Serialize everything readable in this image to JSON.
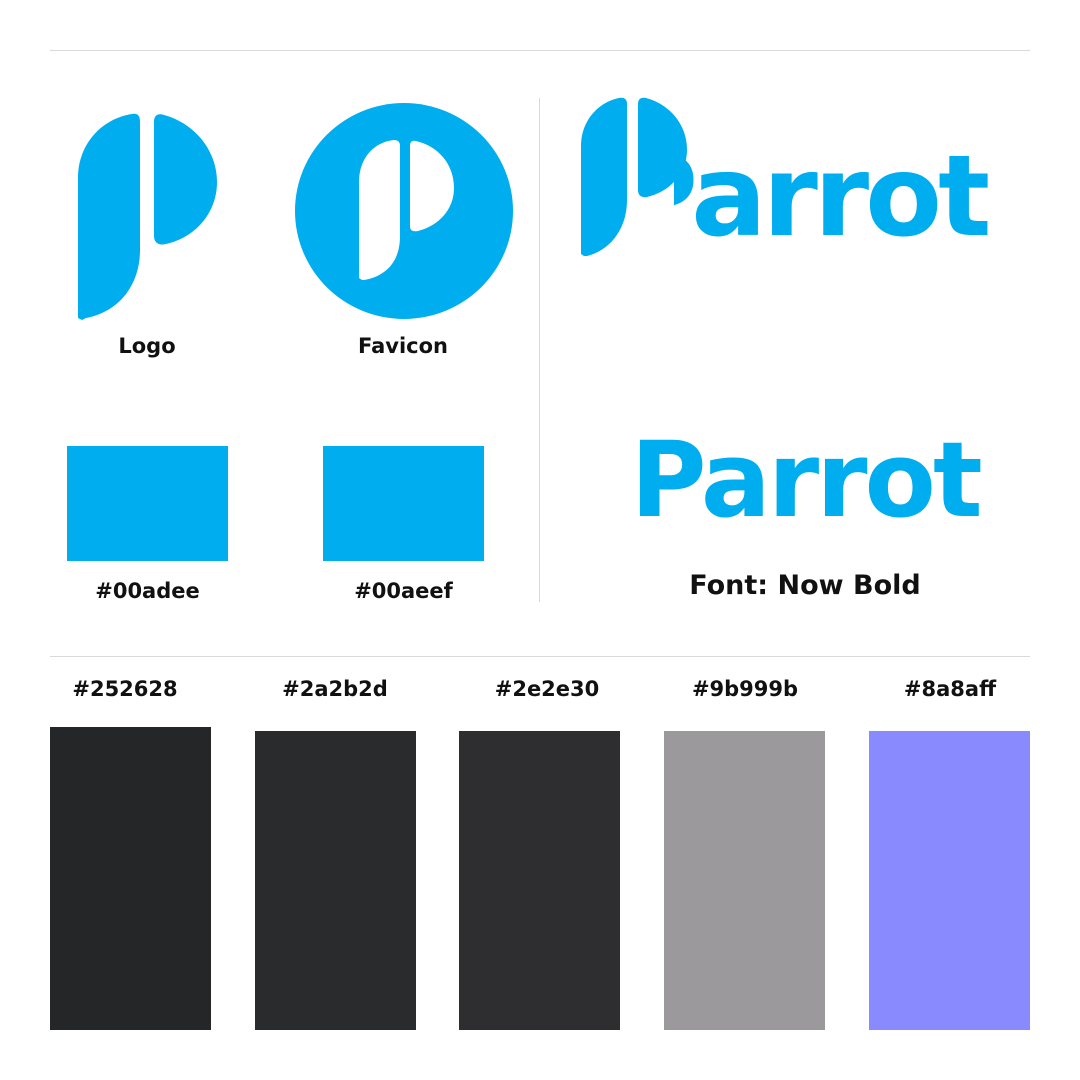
{
  "brand_color": "#00adee",
  "logo": {
    "caption": "Logo",
    "wordmark_text": "Parrot"
  },
  "favicon": {
    "caption": "Favicon"
  },
  "brand_swatches": [
    {
      "hex_label": "#00adee",
      "color": "#00adee"
    },
    {
      "hex_label": "#00aeef",
      "color": "#00aeef"
    }
  ],
  "typography": {
    "sample": "Parrot",
    "font_caption": "Font: Now Bold"
  },
  "palette": [
    {
      "hex_label": "#252628",
      "color": "#252628"
    },
    {
      "hex_label": "#2a2b2d",
      "color": "#2a2b2d"
    },
    {
      "hex_label": "#2e2e30",
      "color": "#2e2e30"
    },
    {
      "hex_label": "#9b999b",
      "color": "#9b999b"
    },
    {
      "hex_label": "#8a8aff",
      "color": "#8a8aff"
    }
  ]
}
